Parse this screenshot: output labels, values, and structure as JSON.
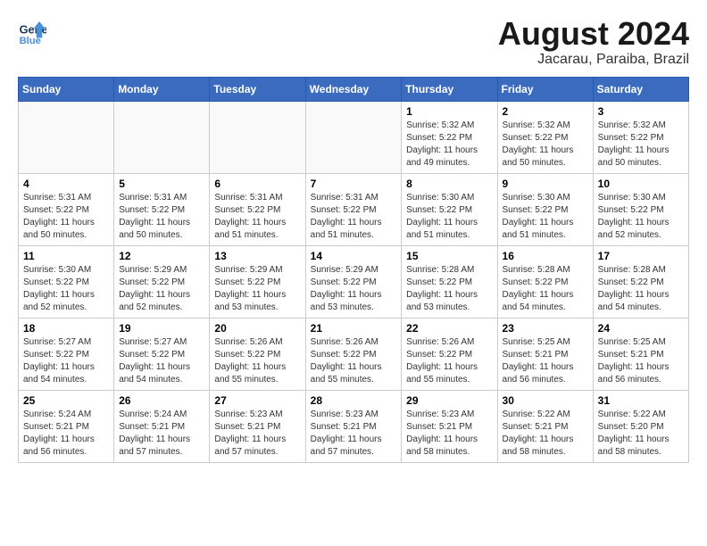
{
  "header": {
    "logo_line1": "General",
    "logo_line2": "Blue",
    "month_title": "August 2024",
    "subtitle": "Jacarau, Paraiba, Brazil"
  },
  "weekdays": [
    "Sunday",
    "Monday",
    "Tuesday",
    "Wednesday",
    "Thursday",
    "Friday",
    "Saturday"
  ],
  "weeks": [
    [
      {
        "day": "",
        "info": ""
      },
      {
        "day": "",
        "info": ""
      },
      {
        "day": "",
        "info": ""
      },
      {
        "day": "",
        "info": ""
      },
      {
        "day": "1",
        "info": "Sunrise: 5:32 AM\nSunset: 5:22 PM\nDaylight: 11 hours\nand 49 minutes."
      },
      {
        "day": "2",
        "info": "Sunrise: 5:32 AM\nSunset: 5:22 PM\nDaylight: 11 hours\nand 50 minutes."
      },
      {
        "day": "3",
        "info": "Sunrise: 5:32 AM\nSunset: 5:22 PM\nDaylight: 11 hours\nand 50 minutes."
      }
    ],
    [
      {
        "day": "4",
        "info": "Sunrise: 5:31 AM\nSunset: 5:22 PM\nDaylight: 11 hours\nand 50 minutes."
      },
      {
        "day": "5",
        "info": "Sunrise: 5:31 AM\nSunset: 5:22 PM\nDaylight: 11 hours\nand 50 minutes."
      },
      {
        "day": "6",
        "info": "Sunrise: 5:31 AM\nSunset: 5:22 PM\nDaylight: 11 hours\nand 51 minutes."
      },
      {
        "day": "7",
        "info": "Sunrise: 5:31 AM\nSunset: 5:22 PM\nDaylight: 11 hours\nand 51 minutes."
      },
      {
        "day": "8",
        "info": "Sunrise: 5:30 AM\nSunset: 5:22 PM\nDaylight: 11 hours\nand 51 minutes."
      },
      {
        "day": "9",
        "info": "Sunrise: 5:30 AM\nSunset: 5:22 PM\nDaylight: 11 hours\nand 51 minutes."
      },
      {
        "day": "10",
        "info": "Sunrise: 5:30 AM\nSunset: 5:22 PM\nDaylight: 11 hours\nand 52 minutes."
      }
    ],
    [
      {
        "day": "11",
        "info": "Sunrise: 5:30 AM\nSunset: 5:22 PM\nDaylight: 11 hours\nand 52 minutes."
      },
      {
        "day": "12",
        "info": "Sunrise: 5:29 AM\nSunset: 5:22 PM\nDaylight: 11 hours\nand 52 minutes."
      },
      {
        "day": "13",
        "info": "Sunrise: 5:29 AM\nSunset: 5:22 PM\nDaylight: 11 hours\nand 53 minutes."
      },
      {
        "day": "14",
        "info": "Sunrise: 5:29 AM\nSunset: 5:22 PM\nDaylight: 11 hours\nand 53 minutes."
      },
      {
        "day": "15",
        "info": "Sunrise: 5:28 AM\nSunset: 5:22 PM\nDaylight: 11 hours\nand 53 minutes."
      },
      {
        "day": "16",
        "info": "Sunrise: 5:28 AM\nSunset: 5:22 PM\nDaylight: 11 hours\nand 54 minutes."
      },
      {
        "day": "17",
        "info": "Sunrise: 5:28 AM\nSunset: 5:22 PM\nDaylight: 11 hours\nand 54 minutes."
      }
    ],
    [
      {
        "day": "18",
        "info": "Sunrise: 5:27 AM\nSunset: 5:22 PM\nDaylight: 11 hours\nand 54 minutes."
      },
      {
        "day": "19",
        "info": "Sunrise: 5:27 AM\nSunset: 5:22 PM\nDaylight: 11 hours\nand 54 minutes."
      },
      {
        "day": "20",
        "info": "Sunrise: 5:26 AM\nSunset: 5:22 PM\nDaylight: 11 hours\nand 55 minutes."
      },
      {
        "day": "21",
        "info": "Sunrise: 5:26 AM\nSunset: 5:22 PM\nDaylight: 11 hours\nand 55 minutes."
      },
      {
        "day": "22",
        "info": "Sunrise: 5:26 AM\nSunset: 5:22 PM\nDaylight: 11 hours\nand 55 minutes."
      },
      {
        "day": "23",
        "info": "Sunrise: 5:25 AM\nSunset: 5:21 PM\nDaylight: 11 hours\nand 56 minutes."
      },
      {
        "day": "24",
        "info": "Sunrise: 5:25 AM\nSunset: 5:21 PM\nDaylight: 11 hours\nand 56 minutes."
      }
    ],
    [
      {
        "day": "25",
        "info": "Sunrise: 5:24 AM\nSunset: 5:21 PM\nDaylight: 11 hours\nand 56 minutes."
      },
      {
        "day": "26",
        "info": "Sunrise: 5:24 AM\nSunset: 5:21 PM\nDaylight: 11 hours\nand 57 minutes."
      },
      {
        "day": "27",
        "info": "Sunrise: 5:23 AM\nSunset: 5:21 PM\nDaylight: 11 hours\nand 57 minutes."
      },
      {
        "day": "28",
        "info": "Sunrise: 5:23 AM\nSunset: 5:21 PM\nDaylight: 11 hours\nand 57 minutes."
      },
      {
        "day": "29",
        "info": "Sunrise: 5:23 AM\nSunset: 5:21 PM\nDaylight: 11 hours\nand 58 minutes."
      },
      {
        "day": "30",
        "info": "Sunrise: 5:22 AM\nSunset: 5:21 PM\nDaylight: 11 hours\nand 58 minutes."
      },
      {
        "day": "31",
        "info": "Sunrise: 5:22 AM\nSunset: 5:20 PM\nDaylight: 11 hours\nand 58 minutes."
      }
    ]
  ]
}
